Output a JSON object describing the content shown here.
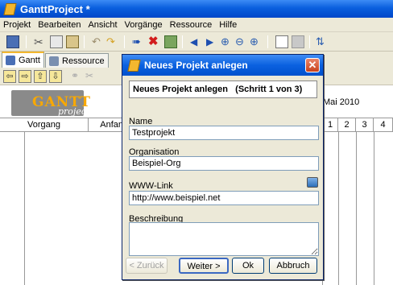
{
  "window": {
    "title": "GanttProject *"
  },
  "menu": [
    "Projekt",
    "Bearbeiten",
    "Ansicht",
    "Vorgänge",
    "Ressource",
    "Hilfe"
  ],
  "tabs": [
    {
      "label": "Gantt",
      "active": true
    },
    {
      "label": "Ressource",
      "active": false
    }
  ],
  "logo": {
    "main": "GANTT",
    "sub": "project"
  },
  "table": {
    "col_task": "Vorgang",
    "col_start": "Anfan"
  },
  "timeline": {
    "month": "Mai 2010",
    "days": [
      "1",
      "2",
      "3",
      "4"
    ]
  },
  "dialog": {
    "title": "Neues Projekt anlegen",
    "step": "Neues Projekt anlegen   (Schritt 1 von 3)",
    "name_label": "Name",
    "name_value": "Testprojekt",
    "org_label": "Organisation",
    "org_value": "Beispiel-Org",
    "link_label": "WWW-Link",
    "link_value": "http://www.beispiel.net",
    "desc_label": "Beschreibung",
    "desc_value": "",
    "buttons": {
      "back": "< Zurück",
      "next": "Weiter >",
      "ok": "Ok",
      "cancel": "Abbruch"
    }
  },
  "colors": {
    "title_blue": "#0a5fde",
    "window_bg": "#ece9d8",
    "logo_orange": "#f8a800"
  }
}
